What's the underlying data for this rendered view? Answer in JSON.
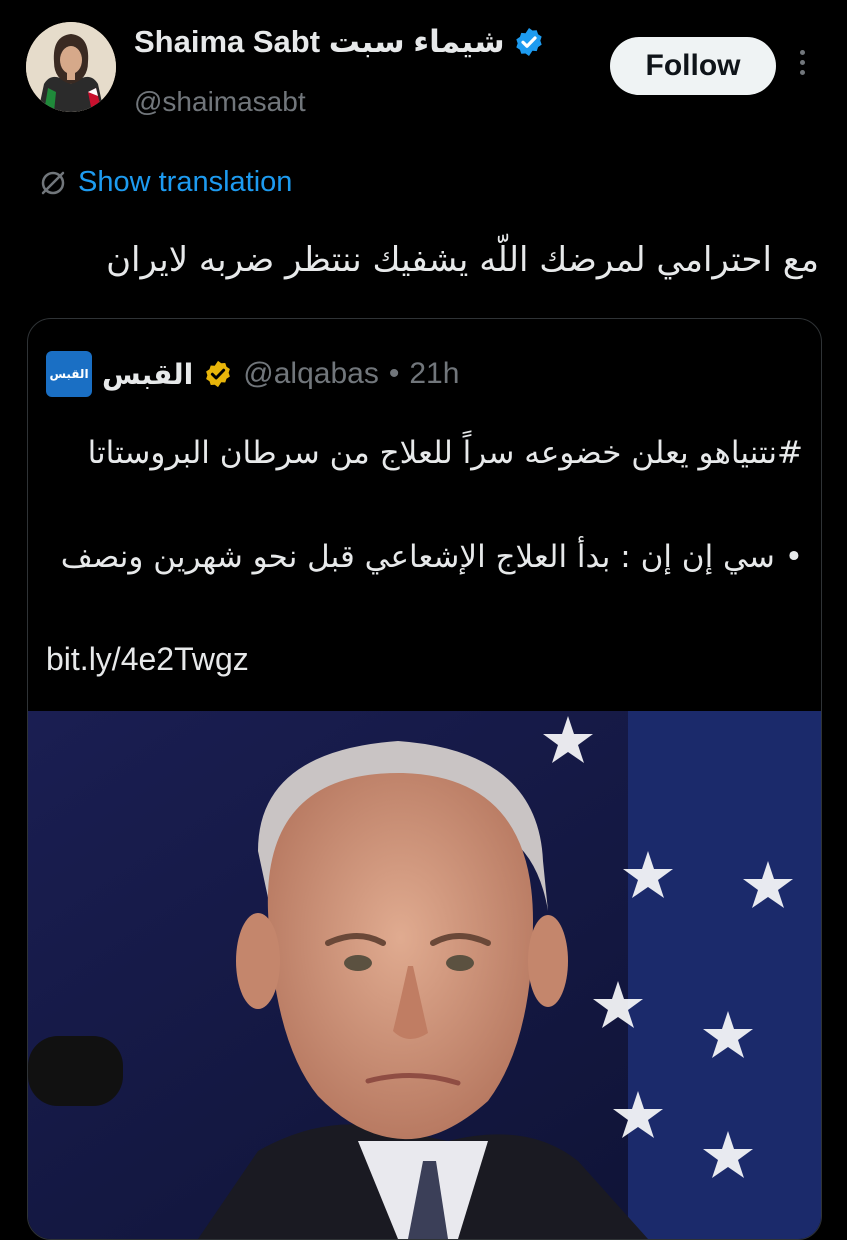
{
  "author": {
    "display_name": "Shaima Sabt شيماء سبت",
    "handle": "@shaimasabt",
    "verified": true,
    "verified_color": "#1d9bf0"
  },
  "follow_label": "Follow",
  "translate_label": "Show translation",
  "tweet_text": "مع احترامي لمرضك اللّه يشفيك ننتظر ضربه لايران",
  "quote": {
    "logo_text": "القبس",
    "name": "القبس",
    "verified_color": "#e8b50a",
    "handle": "@alqabas",
    "separator": "•",
    "time": "21h",
    "line1": "#نتنياهو يعلن خضوعه سراً للعلاج من سرطان البروستاتا",
    "line2": "• سي إن إن : بدأ العلاج الإشعاعي قبل نحو شهرين ونصف",
    "link": "bit.ly/4e2Twgz"
  },
  "icons": [
    "verified-badge-icon",
    "more-icon",
    "translate-icon",
    "gold-verified-badge-icon"
  ],
  "colors": {
    "background": "#000000",
    "link": "#1d9bf0",
    "muted": "#71767b",
    "text": "#e7e9ea"
  }
}
